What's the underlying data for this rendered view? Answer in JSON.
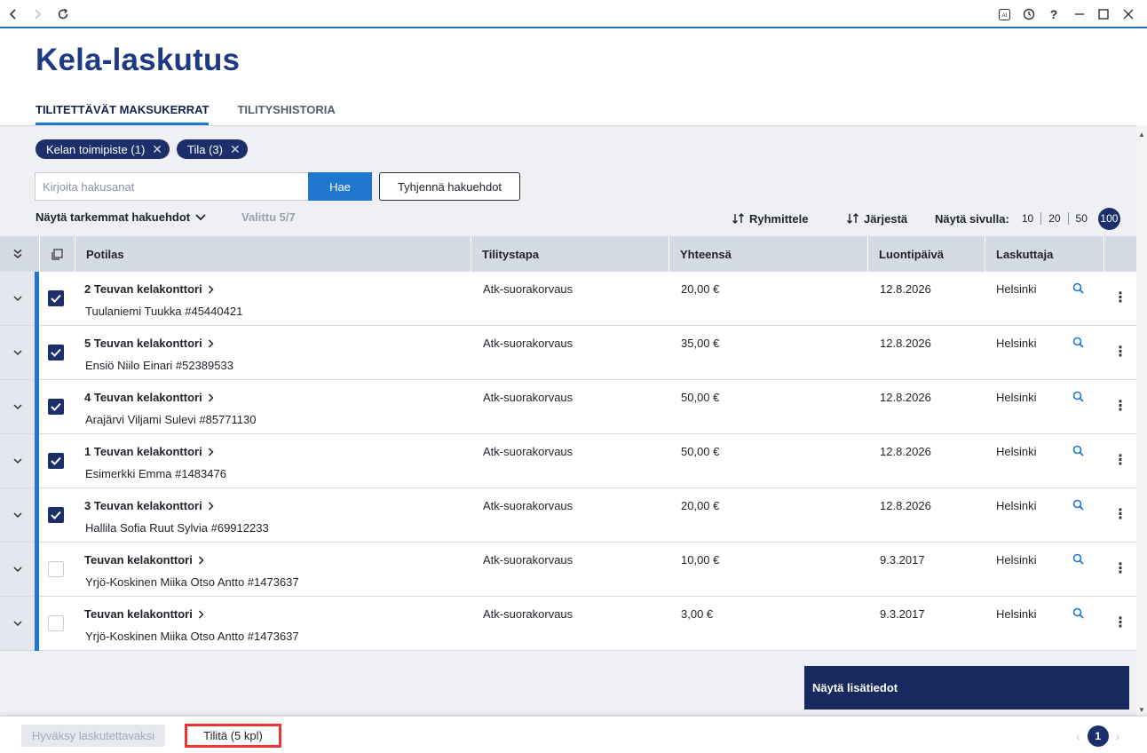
{
  "browser": {
    "back_icon": "chevron-left",
    "forward_icon": "chevron-right",
    "reload_icon": "reload",
    "ai_label": "AI",
    "help_label": "?"
  },
  "page": {
    "title": "Kela-laskutus",
    "tabs": [
      {
        "label": "TILITETTÄVÄT MAKSUKERRAT",
        "active": true
      },
      {
        "label": "TILITYSHISTORIA",
        "active": false
      }
    ]
  },
  "filters": {
    "chips": [
      {
        "label": "Kelan toimipiste (1)"
      },
      {
        "label": "Tila (3)"
      }
    ],
    "search_placeholder": "Kirjoita hakusanat",
    "search_button": "Hae",
    "clear_button": "Tyhjennä hakuehdot",
    "more_filters": "Näytä tarkemmat hakuehdot",
    "selected_count": "Valittu 5/7"
  },
  "toolbar": {
    "group_label": "Ryhmittele",
    "sort_label": "Järjestä",
    "page_size_label": "Näytä sivulla:",
    "page_sizes": [
      "10",
      "20",
      "50",
      "100"
    ],
    "page_size_active": "100"
  },
  "table": {
    "headers": {
      "patient": "Potilas",
      "method": "Tilitystapa",
      "total": "Yhteensä",
      "date": "Luontipäivä",
      "biller": "Laskuttaja"
    },
    "rows": [
      {
        "checked": true,
        "office": "2 Teuvan kelakonttori",
        "patient": "Tuulaniemi Tuukka #45440421",
        "method": "Atk-suorakorvaus",
        "total": "20,00 €",
        "date": "12.8.2026",
        "biller": "Helsinki"
      },
      {
        "checked": true,
        "office": "5 Teuvan kelakonttori",
        "patient": "Ensiö Niilo Einari #52389533",
        "method": "Atk-suorakorvaus",
        "total": "35,00 €",
        "date": "12.8.2026",
        "biller": "Helsinki"
      },
      {
        "checked": true,
        "office": "4 Teuvan kelakonttori",
        "patient": "Arajärvi Viljami Sulevi #85771130",
        "method": "Atk-suorakorvaus",
        "total": "50,00 €",
        "date": "12.8.2026",
        "biller": "Helsinki"
      },
      {
        "checked": true,
        "office": "1 Teuvan kelakonttori",
        "patient": "Esimerkki Emma #1483476",
        "method": "Atk-suorakorvaus",
        "total": "50,00 €",
        "date": "12.8.2026",
        "biller": "Helsinki"
      },
      {
        "checked": true,
        "office": "3 Teuvan kelakonttori",
        "patient": "Hallila Sofia Ruut Sylvia #69912233",
        "method": "Atk-suorakorvaus",
        "total": "20,00 €",
        "date": "12.8.2026",
        "biller": "Helsinki"
      },
      {
        "checked": false,
        "office": "Teuvan kelakonttori",
        "patient": "Yrjö-Koskinen Miika Otso Antto #1473637",
        "method": "Atk-suorakorvaus",
        "total": "10,00 €",
        "date": "9.3.2017",
        "biller": "Helsinki"
      },
      {
        "checked": false,
        "office": "Teuvan kelakonttori",
        "patient": "Yrjö-Koskinen Miika Otso Antto #1473637",
        "method": "Atk-suorakorvaus",
        "total": "3,00 €",
        "date": "9.3.2017",
        "biller": "Helsinki"
      }
    ]
  },
  "details_button": "Näytä lisätiedot",
  "footer": {
    "approve_button": "Hyväksy laskutettavaksi",
    "pay_button": "Tilitä (5 kpl)",
    "current_page": "1"
  },
  "colors": {
    "brand_navy": "#1c2f6b",
    "accent_blue": "#1f77d0",
    "title_blue": "#1e3a82",
    "highlight_red": "#ee3333"
  }
}
